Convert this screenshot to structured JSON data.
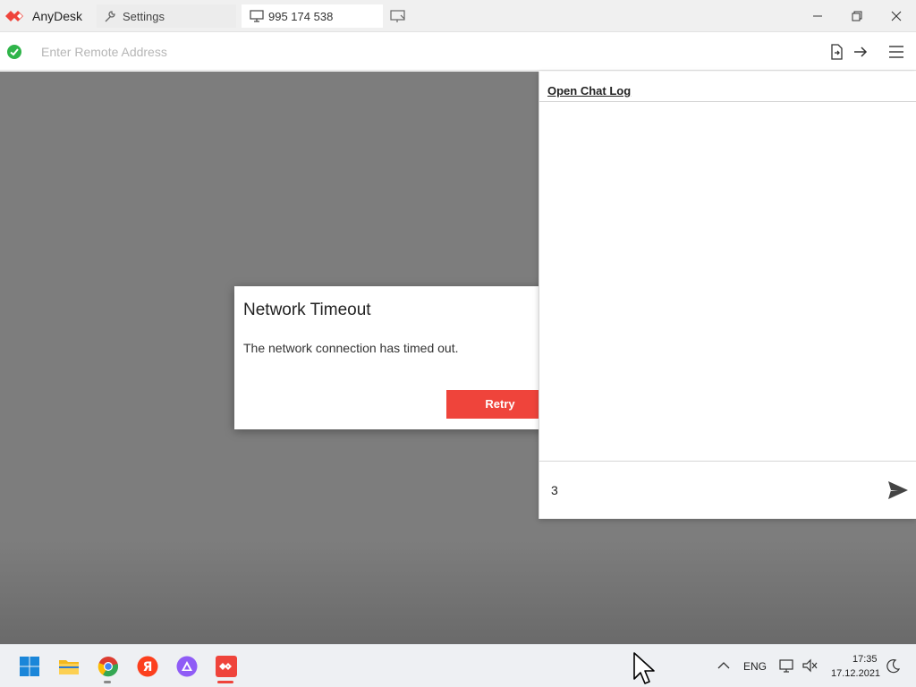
{
  "app": {
    "name": "AnyDesk",
    "brand_color": "#ef443b"
  },
  "tabs": {
    "settings_label": "Settings",
    "session_label": "995 174 538"
  },
  "address_bar": {
    "placeholder": "Enter Remote Address",
    "value": ""
  },
  "dialog": {
    "title": "Network Timeout",
    "message": "The network connection has timed out.",
    "retry_label": "Retry"
  },
  "chat": {
    "open_log_label": "Open Chat Log",
    "input_value": "3"
  },
  "taskbar": {
    "language": "ENG",
    "time": "17:35",
    "date": "17.12.2021",
    "pinned": [
      "start-icon",
      "file-explorer-icon",
      "chrome-icon",
      "yandex-browser-icon",
      "alice-icon",
      "anydesk-taskbar-icon"
    ]
  }
}
